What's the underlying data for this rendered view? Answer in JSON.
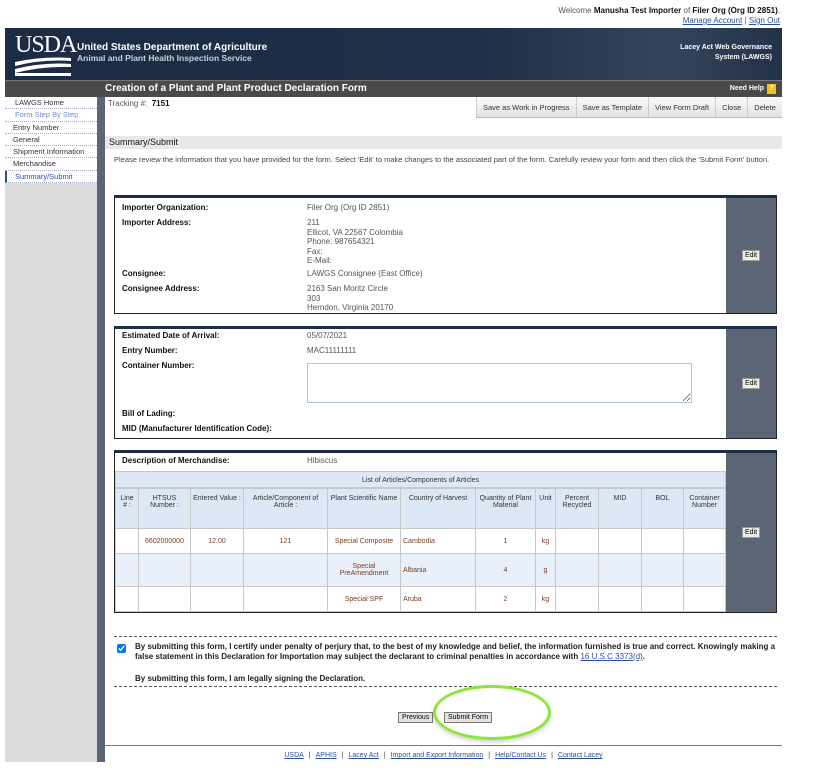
{
  "welcome": {
    "prefix": "Welcome",
    "user": "Manusha Test Importer",
    "of": "of",
    "org": "Filer Org (Org ID 2851)",
    "manage": "Manage Account",
    "sep": "|",
    "signout": "Sign Out"
  },
  "banner": {
    "logo": "USDA",
    "dept": "United States Department of Agriculture",
    "agency": "Animal and Plant Health Inspection Service",
    "system_line1": "Lacey Act Web Governance",
    "system_line2": "System (LAWGS)"
  },
  "titlebar": {
    "title": "Creation of a Plant and Plant Product Declaration Form",
    "help": "Need Help",
    "help_icon": "?"
  },
  "sidebar": {
    "home": "LAWGS Home",
    "step": "Form Step By Step",
    "items": [
      "Entry Number",
      "General",
      "Shipment Information",
      "Merchandise",
      "Summary/Submit"
    ]
  },
  "tracking": {
    "label": "Tracking #:",
    "value": "7151"
  },
  "toolbar": [
    "Save as Work in Progress",
    "Save as Template",
    "View Form Draft",
    "Close",
    "Delete"
  ],
  "section_title": "Summary/Submit",
  "intro": "Please review the information that you have provided for the form. Select 'Edit' to make changes to the associated part of the form. Carefully review your form and then click the 'Submit Form' button.",
  "edit_label": "Edit",
  "box1": {
    "importer_org_label": "Importer Organization:",
    "importer_org": "Filer Org (Org ID 2851)",
    "importer_addr_label": "Importer Address:",
    "importer_addr": [
      "211",
      "Ellicot, VA 22567 Colombia",
      "Phone: 987654321",
      "Fax:",
      "E-Mail:"
    ],
    "consignee_label": "Consignee:",
    "consignee": "LAWGS Consignee (East Office)",
    "consignee_addr_label": "Consignee Address:",
    "consignee_addr": [
      "2163 San Moritz Circle",
      "303",
      "Herndon, Virginia 20170"
    ]
  },
  "box2": {
    "eda_label": "Estimated Date of Arrival:",
    "eda": "05/07/2021",
    "entry_label": "Entry Number:",
    "entry": "MAC11111111",
    "container_label": "Container Number:",
    "container": "",
    "bol_label": "Bill of Lading:",
    "mid_label": "MID (Manufacturer Identification Code):"
  },
  "box3": {
    "desc_label": "Description of Merchandise:",
    "desc": "Hibiscus",
    "caption": "List of Articles/Components of Articles",
    "headers": [
      "Line # :",
      "HTSUS Number :",
      "Entered Value :",
      "Article/Component of Article :",
      "Plant Scientific Name",
      "Country of Harvest",
      "Quantity of Plant Material",
      "Unit",
      "Percent Recycled",
      "MID",
      "BOL",
      "Container Number"
    ],
    "rows": [
      [
        "",
        "6602000000",
        "12.00",
        "121",
        "Special Composite",
        "Cambodia",
        "1",
        "kg",
        "",
        "",
        "",
        ""
      ],
      [
        "",
        "",
        "",
        "",
        "Special PreAmendment",
        "Albania",
        "4",
        "g",
        "",
        "",
        "",
        ""
      ],
      [
        "",
        "",
        "",
        "",
        "Special SPF",
        "Aruba",
        "2",
        "kg",
        "",
        "",
        "",
        ""
      ]
    ]
  },
  "cert": {
    "checked": true,
    "text1": "By submitting this form, I certify under penalty of perjury that, to the best of my knowledge and belief, the information furnished is true and correct. Knowingly making a false statement in this Declaration for Importation may subject the declarant to criminal penalties in accordance with",
    "link": "16 U.S.C 3373(d)",
    "end": ".",
    "text2": "By submitting this form, I am legally signing the Declaration."
  },
  "buttons": {
    "previous": "Previous",
    "submit": "Submit Form"
  },
  "footer": [
    "USDA",
    "APHIS",
    "Lacey Act",
    "Import and Export Information",
    "Help/Contact Us",
    "Contact Lacey"
  ],
  "colors": {
    "banner": "#1e2e48",
    "titlebar": "#4a4a4a",
    "edit_column": "#5b6675",
    "highlight": "#8ee43a"
  }
}
